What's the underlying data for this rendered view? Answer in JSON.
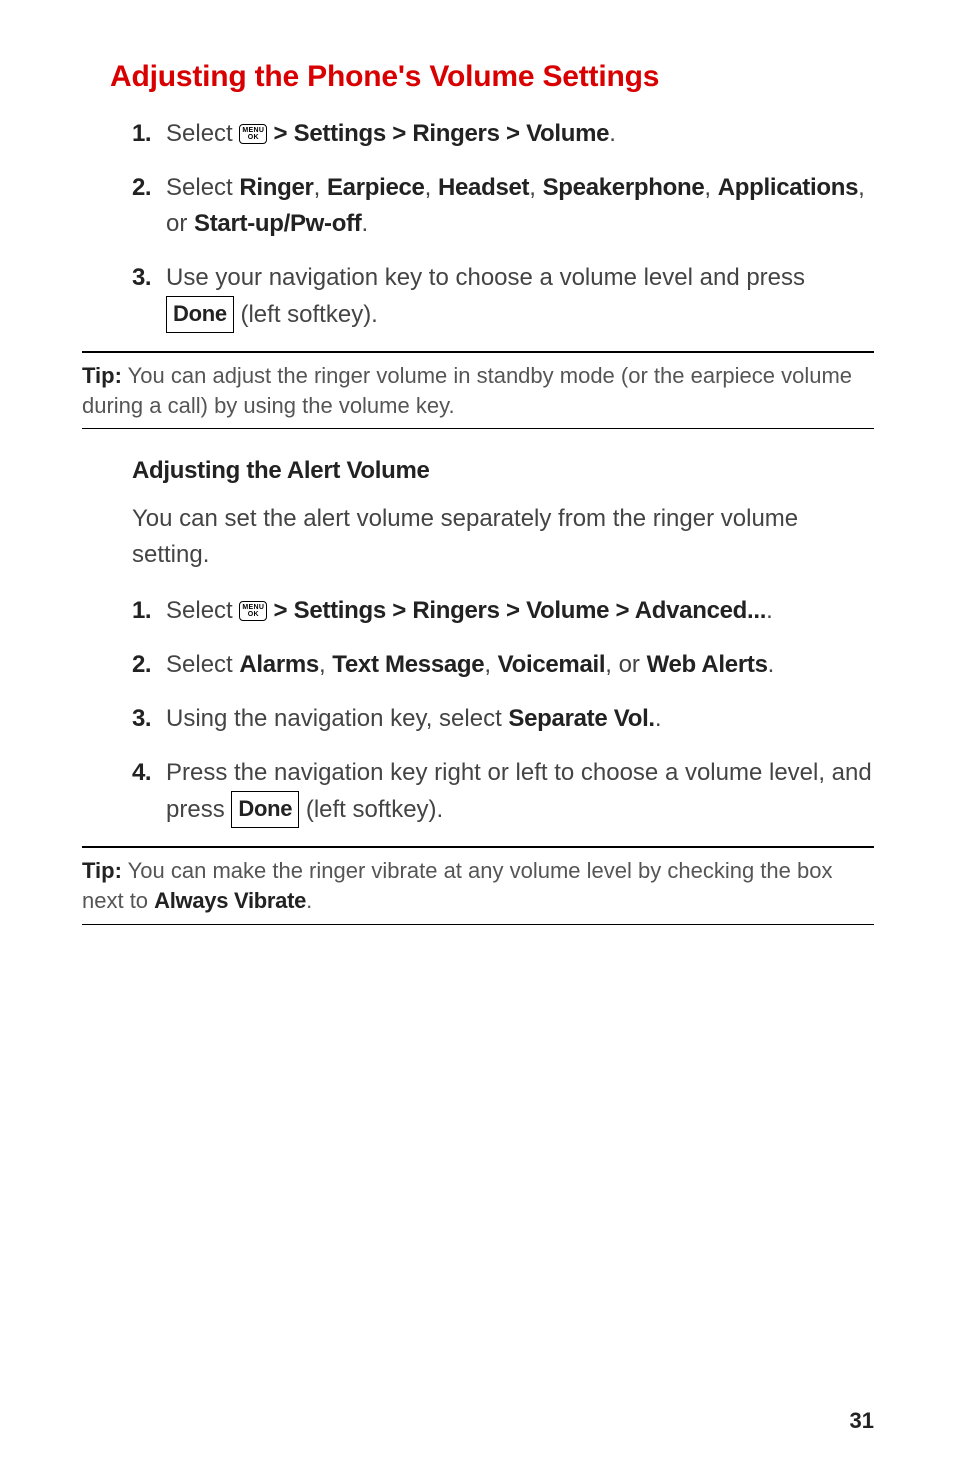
{
  "section1": {
    "title": "Adjusting the Phone's Volume Settings",
    "steps": [
      {
        "num": "1.",
        "pre": "Select ",
        "path": " > Settings > Ringers > Volume",
        "post": "."
      },
      {
        "num": "2.",
        "text_pre": "Select ",
        "opt1": "Ringer",
        "c1": ", ",
        "opt2": "Earpiece",
        "c2": ", ",
        "opt3": "Headset",
        "c3": ", ",
        "opt4": "Speakerphone",
        "c4": ", ",
        "opt5": "Applications",
        "c5": ", or ",
        "opt6": "Start-up/Pw-off",
        "post": "."
      },
      {
        "num": "3.",
        "text_a": "Use your navigation key to choose  a volume level and press ",
        "key": "Done",
        "text_b": " (left softkey)."
      }
    ]
  },
  "tip1": {
    "label": "Tip:",
    "text": " You can adjust the ringer volume in standby mode (or the earpiece volume during a call) by using the volume key."
  },
  "section2": {
    "title": "Adjusting the Alert Volume",
    "intro": "You can set the alert volume separately from the ringer volume setting.",
    "steps": [
      {
        "num": "1.",
        "pre": "Select ",
        "path": " > Settings > Ringers > Volume > Advanced...",
        "post": "."
      },
      {
        "num": "2.",
        "pre": "Select ",
        "o1": "Alarms",
        "c1": ", ",
        "o2": "Text Message",
        "c2": ", ",
        "o3": "Voicemail",
        "c3": ", or  ",
        "o4": "Web Alerts",
        "post": "."
      },
      {
        "num": "3.",
        "pre": "Using the navigation key, select ",
        "b": "Separate Vol.",
        "post": "."
      },
      {
        "num": "4.",
        "pre": "Press the navigation key right or left to choose a volume level, and press ",
        "key": "Done",
        "post": " (left softkey)."
      }
    ]
  },
  "tip2": {
    "label": "Tip:",
    "text_a": " You can make the ringer vibrate at any volume level by checking the box next to ",
    "bold": "Always Vibrate",
    "text_b": "."
  },
  "menuok": {
    "line1": "MENU",
    "line2": "OK"
  },
  "pageNum": "31"
}
